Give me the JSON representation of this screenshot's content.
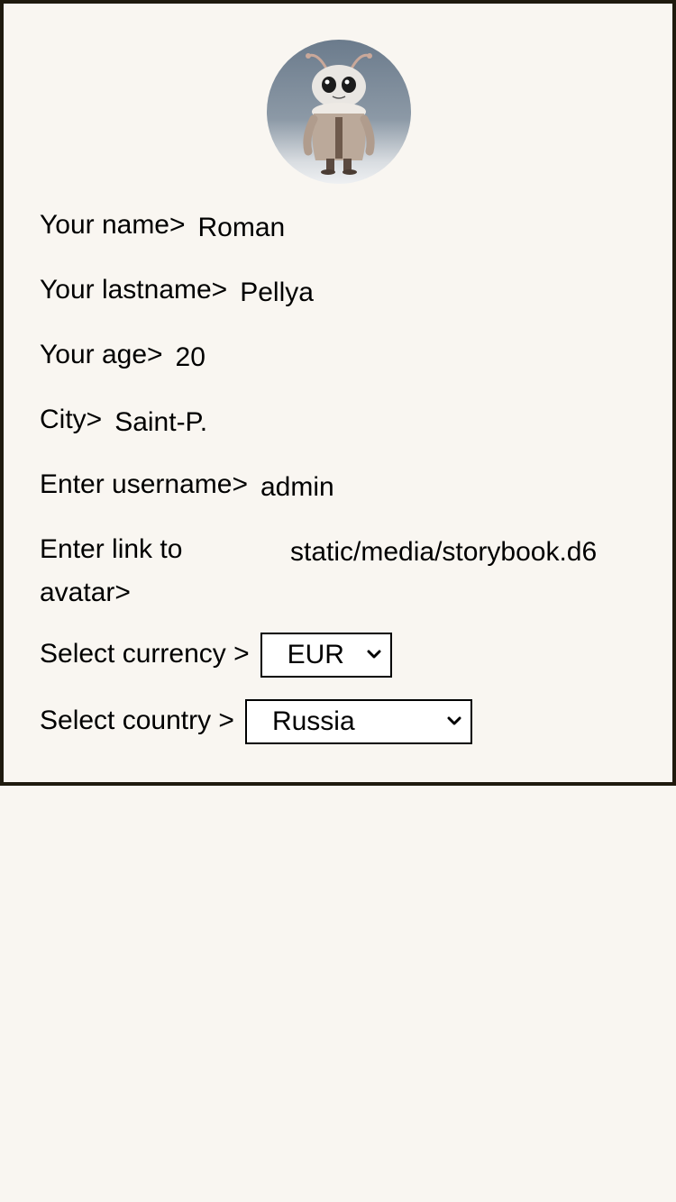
{
  "avatar": {
    "icon": "furry-creature-avatar"
  },
  "fields": {
    "name": {
      "label": "Your name>",
      "value": "Roman"
    },
    "lastname": {
      "label": "Your lastname>",
      "value": "Pellya"
    },
    "age": {
      "label": "Your age>",
      "value": "20"
    },
    "city": {
      "label": "City>",
      "value": "Saint-P."
    },
    "username": {
      "label": "Enter username>",
      "value": "admin"
    },
    "avatar_link": {
      "label": "Enter link to avatar>",
      "value": "static/media/storybook.d6"
    }
  },
  "currency": {
    "label": "Select currency >",
    "selected": "EUR"
  },
  "country": {
    "label": "Select country >",
    "selected": "Russia"
  },
  "colors": {
    "border": "#1f1a0e",
    "background": "#f9f6f1"
  }
}
